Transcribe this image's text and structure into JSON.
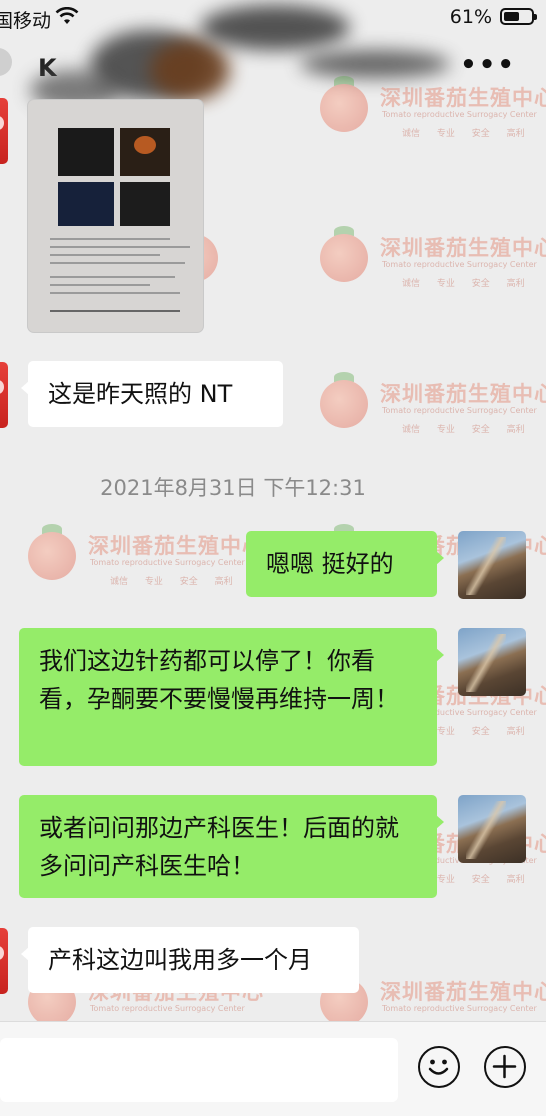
{
  "status_bar": {
    "carrier": "国移动",
    "battery_percent": "61%",
    "battery_level": 0.61
  },
  "nav": {
    "title": "K",
    "more_label": "•••"
  },
  "watermark": {
    "name": "深圳番茄生殖中心",
    "english": "Tomato reproductive Surrogacy Center",
    "tags": "诚信 专业 安全 高利"
  },
  "messages": [
    {
      "side": "left",
      "type": "image",
      "description": "ultrasound-report-photo"
    },
    {
      "side": "left",
      "type": "text",
      "text": "这是昨天照的 NT"
    },
    {
      "side": "right",
      "type": "text",
      "text": "嗯嗯 挺好的"
    },
    {
      "side": "right",
      "type": "text",
      "text": "我们这边针药都可以停了！你看看，孕酮要不要慢慢再维持一周！"
    },
    {
      "side": "right",
      "type": "text",
      "text": "或者问问那边产科医生！后面的就多问问产科医生哈！"
    },
    {
      "side": "left",
      "type": "text",
      "text": "产科这边叫我用多一个月"
    }
  ],
  "timestamp": "2021年8月31日 下午12:31",
  "input_bar": {
    "placeholder": "",
    "emoji_icon": "smiley-icon",
    "plus_icon": "plus-icon"
  },
  "colors": {
    "background": "#ededed",
    "sent_bubble": "#95ec69",
    "received_bubble": "#ffffff"
  }
}
